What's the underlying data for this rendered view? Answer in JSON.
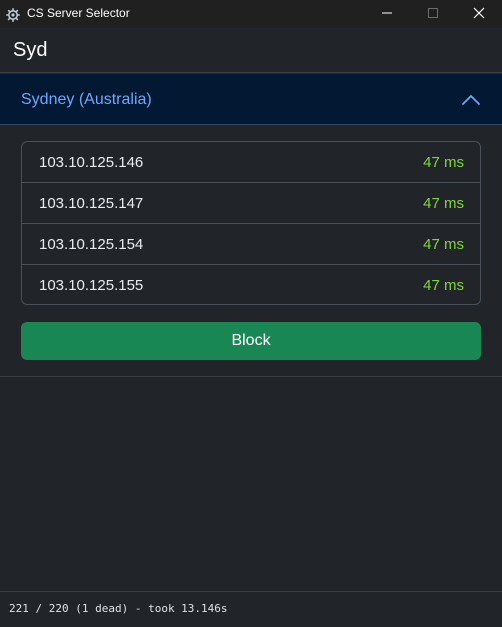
{
  "window": {
    "title": "CS Server Selector",
    "icon": "gear-icon",
    "controls": [
      "minimize-icon",
      "maximize-icon",
      "close-icon"
    ]
  },
  "header": {
    "title": "Syd"
  },
  "region": {
    "label": "Sydney (Australia)",
    "expanded": true,
    "servers": [
      {
        "ip": "103.10.125.146",
        "ping": "47 ms"
      },
      {
        "ip": "103.10.125.147",
        "ping": "47 ms"
      },
      {
        "ip": "103.10.125.154",
        "ping": "47 ms"
      },
      {
        "ip": "103.10.125.155",
        "ping": "47 ms"
      }
    ],
    "action_label": "Block"
  },
  "status": {
    "text": "221 / 220 (1 dead) - took 13.146s"
  },
  "colors": {
    "background": "#212529",
    "accordion_bg": "#031833",
    "accent_text": "#6ea8fe",
    "ping_green": "#7fd63a",
    "button_green": "#198754"
  }
}
